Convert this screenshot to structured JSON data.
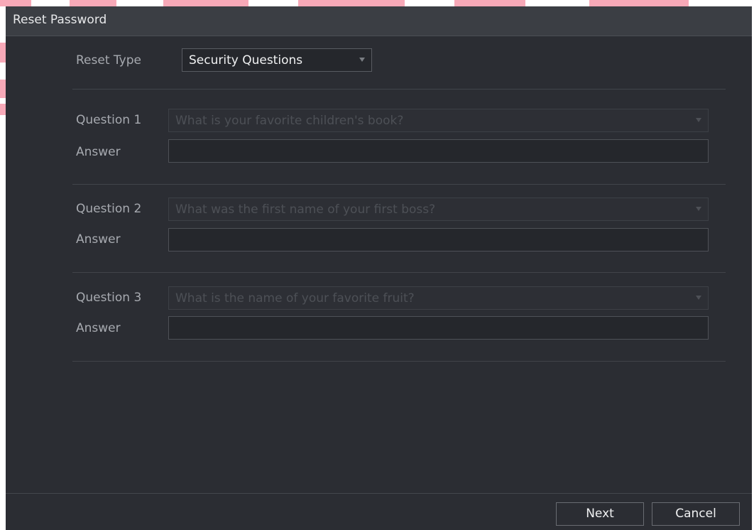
{
  "dialog": {
    "title": "Reset Password"
  },
  "reset_type": {
    "label": "Reset Type",
    "value": "Security Questions"
  },
  "questions": [
    {
      "label": "Question 1",
      "value": "What is your favorite children's book?",
      "answer_label": "Answer",
      "answer_value": ""
    },
    {
      "label": "Question 2",
      "value": "What was the first name of your first boss?",
      "answer_label": "Answer",
      "answer_value": ""
    },
    {
      "label": "Question 3",
      "value": "What is the name of your favorite fruit?",
      "answer_label": "Answer",
      "answer_value": ""
    }
  ],
  "buttons": {
    "next": "Next",
    "cancel": "Cancel"
  },
  "colors": {
    "background": "#2b2d33",
    "titlebar": "#3b3e44",
    "watermark": "#f7a9b8"
  }
}
